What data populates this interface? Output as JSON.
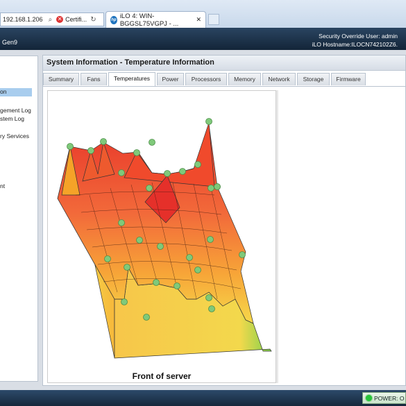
{
  "browser": {
    "address": "192.168.1.206",
    "cert_label": "Certifi...",
    "tab_title": "iLO 4: WIN-BGGSL75VGPJ - ..."
  },
  "header": {
    "model_fragment": "Gen9",
    "override_user": "Security Override User:  admin",
    "hostname": "iLO Hostname:ILOCN742102Z6."
  },
  "leftnav": {
    "items": [
      "on",
      "gement Log",
      "stem Log",
      "ry Services",
      "nt"
    ]
  },
  "page_title": "System Information - Temperature Information",
  "tabs": [
    "Summary",
    "Fans",
    "Temperatures",
    "Power",
    "Processors",
    "Memory",
    "Network",
    "Storage",
    "Firmware"
  ],
  "active_tab": "Temperatures",
  "chart_caption": "Front of server",
  "status": {
    "power": "POWER: O"
  },
  "colors": {
    "hot": "#e8362a",
    "warm": "#f5a623",
    "cool": "#f3e24a",
    "cold": "#6fd14a",
    "sensor": "#7fc97a"
  }
}
